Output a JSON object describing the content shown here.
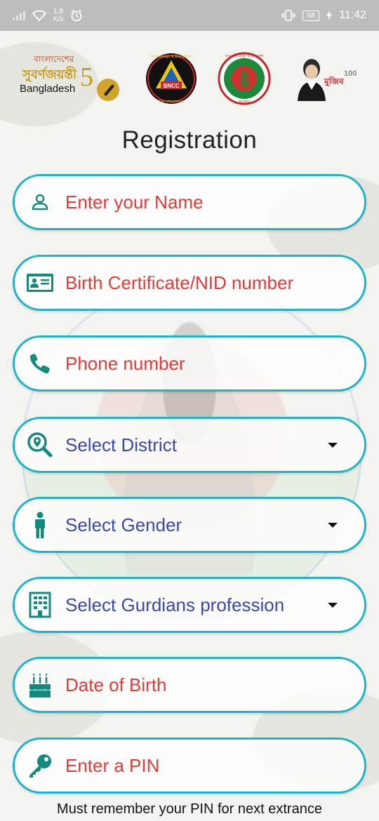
{
  "status_bar": {
    "net_speed_value": "1.8",
    "net_speed_unit": "K/s",
    "battery": "68",
    "time": "11:42",
    "icons": [
      "signal-icon",
      "wifi-icon",
      "alarm-icon",
      "vibrate-icon",
      "battery-icon",
      "charging-icon"
    ]
  },
  "logos": {
    "subarna_line1": "বাংলাদেশের",
    "subarna_line2": "সুবর্ণজয়ন্তী",
    "subarna_country": "Bangladesh",
    "subarna_number": "5",
    "bncc_center": "BNCC",
    "bncc_top": "Knowledge & Discipline",
    "bncc_bottom": "The Volunteers",
    "govt_top": "গণপ্রজাতন্ত্রী বাংলাদেশ",
    "govt_bottom": "সরকার",
    "mujib_text": "মুজিব",
    "mujib_number": "100"
  },
  "page": {
    "title": "Registration"
  },
  "form": {
    "name_placeholder": "Enter your Name",
    "nid_placeholder": "Birth Certificate/NID number",
    "phone_placeholder": "Phone number",
    "district_label": "Select District",
    "gender_label": "Select Gender",
    "profession_label": "Select Gurdians profession",
    "dob_placeholder": "Date of Birth",
    "pin_placeholder": "Enter a PIN",
    "pin_note": "Must remember your PIN for next extrance"
  },
  "colors": {
    "accent_border": "#1fb4c8",
    "icon_teal": "#128a7e",
    "placeholder_red": "#e53935",
    "dropdown_blue": "#3949ab"
  }
}
